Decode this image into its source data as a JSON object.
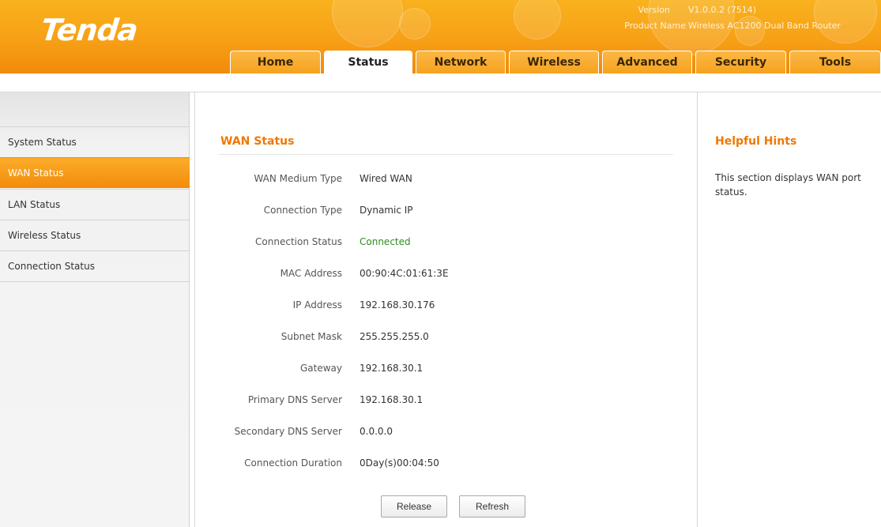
{
  "header": {
    "logo": "Tenda",
    "version_label": "Version",
    "version_value": "V1.0.0.2 (7514)",
    "product_label": "Product Name",
    "product_value": "Wireless AC1200 Dual Band Router"
  },
  "nav": {
    "tabs": [
      "Home",
      "Status",
      "Network",
      "Wireless",
      "Advanced",
      "Security",
      "Tools"
    ],
    "active": "Status"
  },
  "sidebar": {
    "items": [
      "System Status",
      "WAN Status",
      "LAN Status",
      "Wireless Status",
      "Connection Status"
    ],
    "active": "WAN Status"
  },
  "main": {
    "title": "WAN Status",
    "rows": [
      {
        "label": "WAN Medium Type",
        "value": "Wired WAN"
      },
      {
        "label": "Connection Type",
        "value": "Dynamic IP"
      },
      {
        "label": "Connection Status",
        "value": "Connected"
      },
      {
        "label": "MAC Address",
        "value": "00:90:4C:01:61:3E"
      },
      {
        "label": "IP Address",
        "value": "192.168.30.176"
      },
      {
        "label": "Subnet Mask",
        "value": "255.255.255.0"
      },
      {
        "label": "Gateway",
        "value": "192.168.30.1"
      },
      {
        "label": "Primary DNS Server",
        "value": "192.168.30.1"
      },
      {
        "label": "Secondary DNS Server",
        "value": "0.0.0.0"
      },
      {
        "label": "Connection Duration",
        "value": "0Day(s)00:04:50"
      }
    ],
    "release_label": "Release",
    "refresh_label": "Refresh"
  },
  "hints": {
    "title": "Helpful Hints",
    "text": "This section displays WAN port status."
  },
  "colors": {
    "brand_orange": "#f7a016",
    "title_orange": "#f07800",
    "status_green": "#2e8b1f"
  }
}
